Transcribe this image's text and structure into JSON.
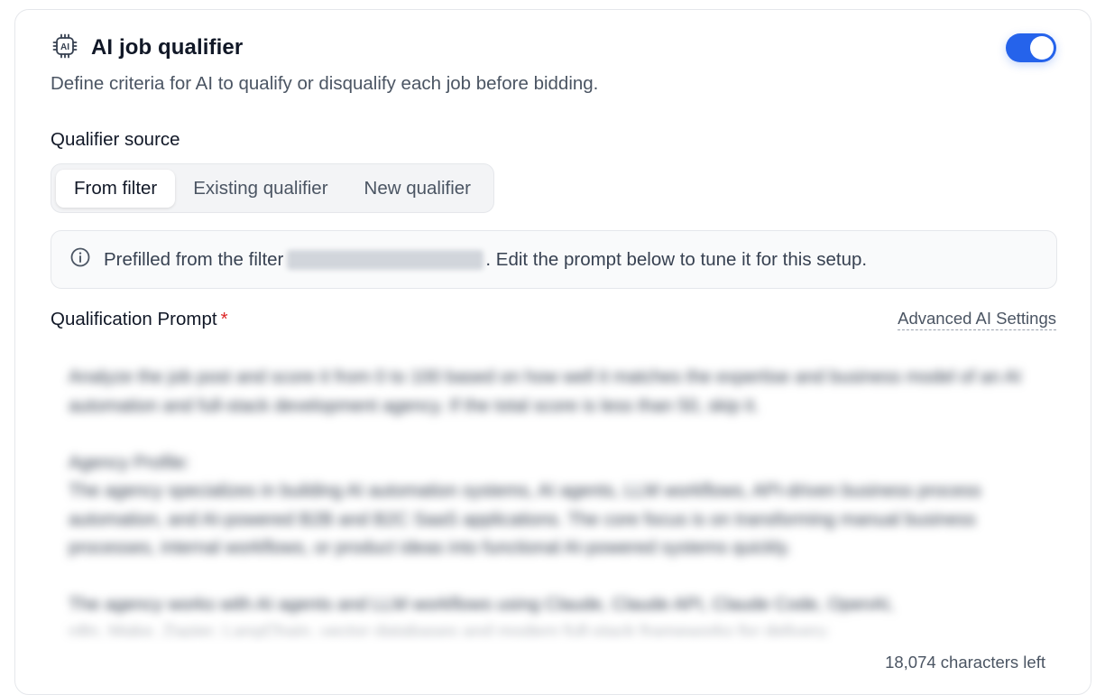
{
  "header": {
    "title": "AI job qualifier",
    "subtitle": "Define criteria for AI to qualify or disqualify each job before bidding.",
    "toggle_on": true,
    "icon": "ai-chip-icon",
    "accent_color": "#2563eb"
  },
  "qualifier_source": {
    "label": "Qualifier source",
    "options": [
      "From filter",
      "Existing qualifier",
      "New qualifier"
    ],
    "selected": "From filter"
  },
  "info_banner": {
    "icon": "info-icon",
    "prefix": "Prefilled from the filter",
    "suffix": ". Edit the prompt below to tune it for this setup."
  },
  "prompt": {
    "label": "Qualification Prompt",
    "required_mark": "*",
    "advanced_link": "Advanced AI Settings",
    "text": "Analyze the job post and score it from 0 to 100 based on how well it matches the expertise and business model of an AI automation and full-stack development agency. If the total score is less than 50, skip it.\n\nAgency Profile:\nThe agency specializes in building AI automation systems, AI agents, LLM workflows, API-driven business process automation, and AI-powered B2B and B2C SaaS applications. The core focus is on transforming manual business processes, internal workflows, or product ideas into functional AI-powered systems quickly.\n\nThe agency works with AI agents and LLM workflows using Claude, Claude API, Claude Code, OpenAI,\nn8n, Make, Zapier, LangChain, vector databases and modern full-stack frameworks for delivery.",
    "chars_left": "18,074 characters left"
  }
}
